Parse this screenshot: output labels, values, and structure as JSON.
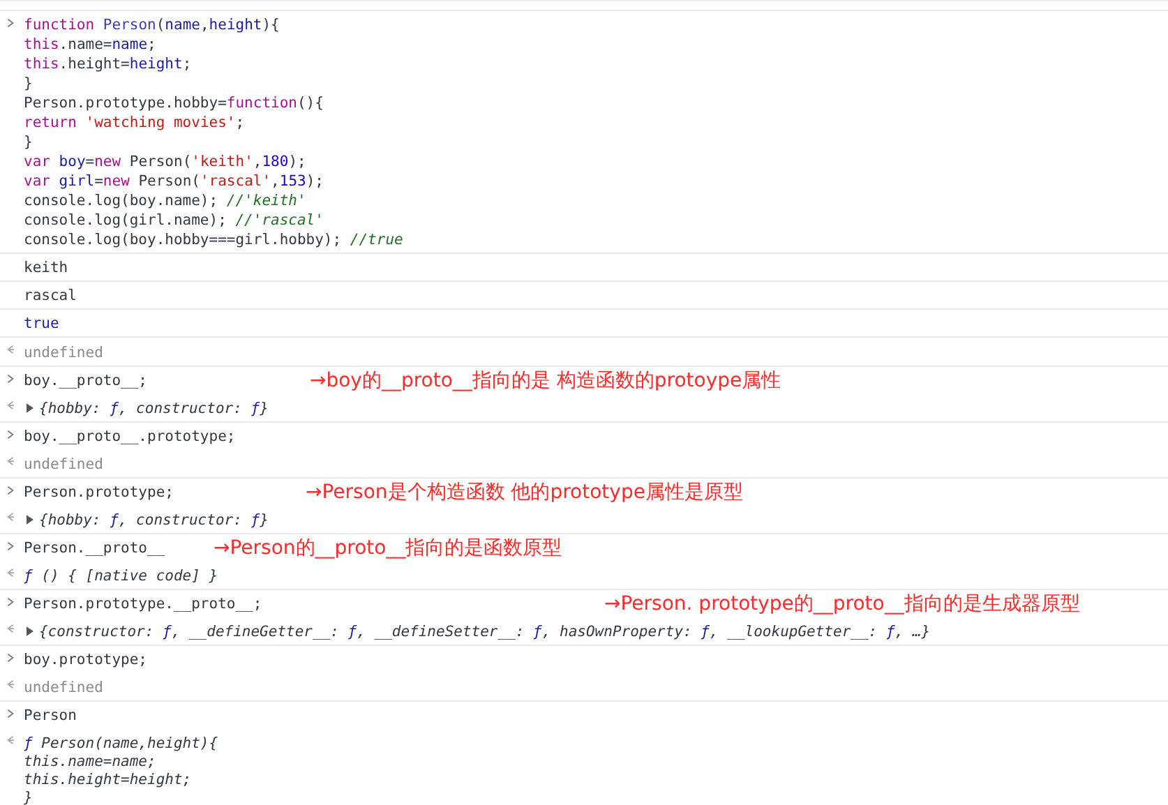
{
  "console": {
    "rows": [
      {
        "kind": "input",
        "lines": [
          [
            {
              "text": "function ",
              "kind": "kw"
            },
            {
              "text": "Person",
              "kind": "def"
            },
            {
              "text": "(",
              "kind": "p"
            },
            {
              "text": "name",
              "kind": "var"
            },
            {
              "text": ",",
              "kind": "p"
            },
            {
              "text": "height",
              "kind": "var"
            },
            {
              "text": "){",
              "kind": "p"
            }
          ],
          [
            {
              "text": "this",
              "kind": "kw"
            },
            {
              "text": ".name=",
              "kind": "p"
            },
            {
              "text": "name",
              "kind": "var"
            },
            {
              "text": ";",
              "kind": "p"
            }
          ],
          [
            {
              "text": "this",
              "kind": "kw"
            },
            {
              "text": ".height=",
              "kind": "p"
            },
            {
              "text": "height",
              "kind": "var"
            },
            {
              "text": ";",
              "kind": "p"
            }
          ],
          [
            {
              "text": "}",
              "kind": "p"
            }
          ],
          [
            {
              "text": "Person.prototype.hobby=",
              "kind": "p"
            },
            {
              "text": "function",
              "kind": "kw"
            },
            {
              "text": "(){",
              "kind": "p"
            }
          ],
          [
            {
              "text": "return ",
              "kind": "kw"
            },
            {
              "text": "'watching movies'",
              "kind": "str"
            },
            {
              "text": ";",
              "kind": "p"
            }
          ],
          [
            {
              "text": "}",
              "kind": "p"
            }
          ],
          [
            {
              "text": "var ",
              "kind": "kw"
            },
            {
              "text": "boy",
              "kind": "var"
            },
            {
              "text": "=",
              "kind": "p"
            },
            {
              "text": "new",
              "kind": "kw"
            },
            {
              "text": " Person(",
              "kind": "p"
            },
            {
              "text": "'keith'",
              "kind": "str"
            },
            {
              "text": ",",
              "kind": "p"
            },
            {
              "text": "180",
              "kind": "num"
            },
            {
              "text": ");",
              "kind": "p"
            }
          ],
          [
            {
              "text": "var ",
              "kind": "kw"
            },
            {
              "text": "girl",
              "kind": "var"
            },
            {
              "text": "=",
              "kind": "p"
            },
            {
              "text": "new",
              "kind": "kw"
            },
            {
              "text": " Person(",
              "kind": "p"
            },
            {
              "text": "'rascal'",
              "kind": "str"
            },
            {
              "text": ",",
              "kind": "p"
            },
            {
              "text": "153",
              "kind": "num"
            },
            {
              "text": ");",
              "kind": "p"
            }
          ],
          [
            {
              "text": "console.log(boy.name); ",
              "kind": "p"
            },
            {
              "text": "//'keith'",
              "kind": "cm"
            }
          ],
          [
            {
              "text": "console.log(girl.name); ",
              "kind": "p"
            },
            {
              "text": "//'rascal'",
              "kind": "cm"
            }
          ],
          [
            {
              "text": "console.log(boy.hobby===girl.hobby); ",
              "kind": "p"
            },
            {
              "text": "//true",
              "kind": "cm"
            }
          ]
        ]
      },
      {
        "kind": "log",
        "lines": [
          [
            {
              "text": "keith",
              "kind": "p"
            }
          ]
        ]
      },
      {
        "kind": "log",
        "lines": [
          [
            {
              "text": "rascal",
              "kind": "p"
            }
          ]
        ]
      },
      {
        "kind": "log",
        "lines": [
          [
            {
              "text": "true",
              "kind": "bool"
            }
          ]
        ]
      },
      {
        "kind": "result",
        "expandable": false,
        "lines": [
          [
            {
              "text": "undefined",
              "kind": "undef"
            }
          ]
        ]
      },
      {
        "kind": "input",
        "lines": [
          [
            {
              "text": "boy.__proto__;",
              "kind": "p"
            }
          ]
        ],
        "annotation": "→boy的__proto__指向的是 构造函数的protoype属性"
      },
      {
        "kind": "result",
        "expandable": true,
        "lines": [
          [
            {
              "text": "{hobby: ",
              "kind": "it"
            },
            {
              "text": "ƒ",
              "kind": "fsym"
            },
            {
              "text": ", constructor: ",
              "kind": "it"
            },
            {
              "text": "ƒ",
              "kind": "fsym"
            },
            {
              "text": "}",
              "kind": "it"
            }
          ]
        ]
      },
      {
        "kind": "input",
        "lines": [
          [
            {
              "text": "boy.__proto__.prototype;",
              "kind": "p"
            }
          ]
        ]
      },
      {
        "kind": "result",
        "expandable": false,
        "lines": [
          [
            {
              "text": "undefined",
              "kind": "undef"
            }
          ]
        ]
      },
      {
        "kind": "input",
        "lines": [
          [
            {
              "text": "Person.prototype;",
              "kind": "p"
            }
          ]
        ],
        "annotation": "→Person是个构造函数 他的prototype属性是原型"
      },
      {
        "kind": "result",
        "expandable": true,
        "lines": [
          [
            {
              "text": "{hobby: ",
              "kind": "it"
            },
            {
              "text": "ƒ",
              "kind": "fsym"
            },
            {
              "text": ", constructor: ",
              "kind": "it"
            },
            {
              "text": "ƒ",
              "kind": "fsym"
            },
            {
              "text": "}",
              "kind": "it"
            }
          ]
        ]
      },
      {
        "kind": "input",
        "lines": [
          [
            {
              "text": "Person.__proto__",
              "kind": "p"
            }
          ]
        ],
        "annotation": "→Person的__proto__指向的是函数原型"
      },
      {
        "kind": "result",
        "expandable": false,
        "lines": [
          [
            {
              "text": "ƒ",
              "kind": "fsym"
            },
            {
              "text": " () { [native code] }",
              "kind": "it"
            }
          ]
        ]
      },
      {
        "kind": "input",
        "lines": [
          [
            {
              "text": "Person.prototype.__proto__;",
              "kind": "p"
            }
          ]
        ],
        "annotation": "→Person. prototype的__proto__指向的是生成器原型"
      },
      {
        "kind": "result",
        "expandable": true,
        "lines": [
          [
            {
              "text": "{constructor: ",
              "kind": "it"
            },
            {
              "text": "ƒ",
              "kind": "fsym"
            },
            {
              "text": ", __defineGetter__: ",
              "kind": "it"
            },
            {
              "text": "ƒ",
              "kind": "fsym"
            },
            {
              "text": ", __defineSetter__: ",
              "kind": "it"
            },
            {
              "text": "ƒ",
              "kind": "fsym"
            },
            {
              "text": ", hasOwnProperty: ",
              "kind": "it"
            },
            {
              "text": "ƒ",
              "kind": "fsym"
            },
            {
              "text": ", __lookupGetter__: ",
              "kind": "it"
            },
            {
              "text": "ƒ",
              "kind": "fsym"
            },
            {
              "text": ", …}",
              "kind": "it"
            }
          ]
        ]
      },
      {
        "kind": "input",
        "lines": [
          [
            {
              "text": "boy.prototype;",
              "kind": "p"
            }
          ]
        ]
      },
      {
        "kind": "result",
        "expandable": false,
        "lines": [
          [
            {
              "text": "undefined",
              "kind": "undef"
            }
          ]
        ]
      },
      {
        "kind": "input",
        "lines": [
          [
            {
              "text": "Person",
              "kind": "p"
            }
          ]
        ]
      },
      {
        "kind": "result",
        "expandable": false,
        "lines": [
          [
            {
              "text": "ƒ",
              "kind": "fsym"
            },
            {
              "text": " Person(name,height){",
              "kind": "it"
            }
          ],
          [
            {
              "text": "this.name=name;",
              "kind": "it"
            }
          ],
          [
            {
              "text": "this.height=height;",
              "kind": "it"
            }
          ],
          [
            {
              "text": "}",
              "kind": "it"
            }
          ]
        ]
      }
    ]
  }
}
